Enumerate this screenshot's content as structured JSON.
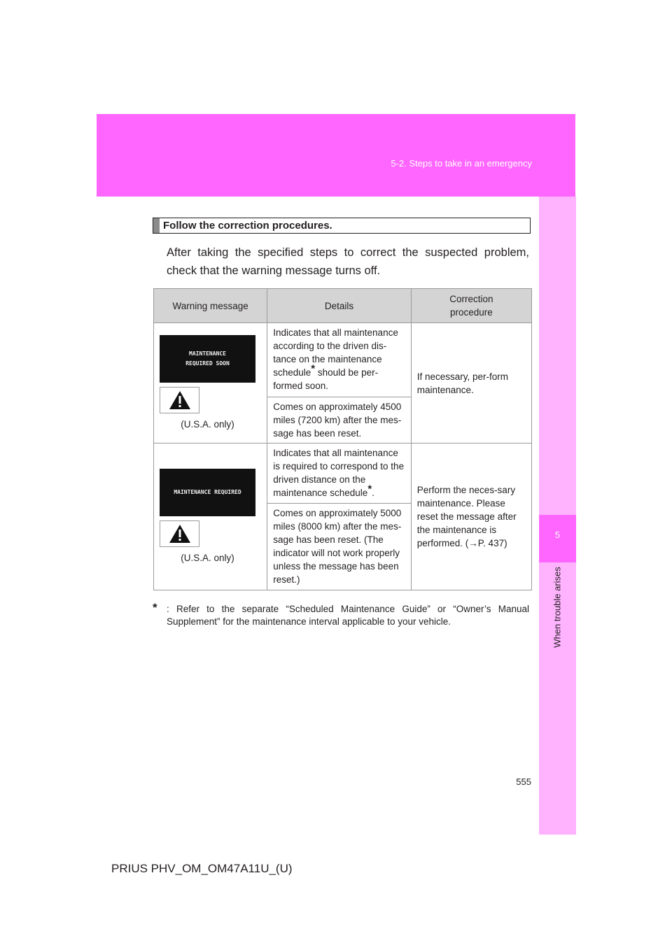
{
  "header": {
    "section": "5-2. Steps to take in an emergency"
  },
  "side_tab": {
    "chapter_number": "5",
    "chapter_title": "When trouble arises"
  },
  "step": {
    "heading": "Follow the correction procedures.",
    "intro": "After taking the specified steps to correct the suspected problem, check that the warning message turns off."
  },
  "table": {
    "headers": {
      "warning_message": "Warning message",
      "details": "Details",
      "correction": "Correction procedure"
    },
    "rows": [
      {
        "screen_lines": [
          "MAINTENANCE",
          "REQUIRED SOON"
        ],
        "note": "(U.S.A. only)",
        "details_1_before": "Indicates that all maintenance according to the driven dis-tance on the maintenance schedule",
        "details_1_after": " should be per-formed soon.",
        "details_2": "Comes on approximately 4500 miles (7200 km) after the mes-sage has been reset.",
        "correction": "If necessary, per-form maintenance."
      },
      {
        "screen_lines": [
          "MAINTENANCE REQUIRED"
        ],
        "note": "(U.S.A. only)",
        "details_1_before": "Indicates that all maintenance is required to correspond to the driven distance on the maintenance schedule",
        "details_1_after": ".",
        "details_2": "Comes on approximately 5000 miles (8000 km) after the mes-sage has been reset. (The indicator will not work properly unless the message has been reset.)",
        "correction": "Perform the neces-sary maintenance. Please reset the message after the maintenance is performed. (→P. 437)"
      }
    ],
    "asterisk": "*"
  },
  "footnote": {
    "mark": "*",
    "text": ": Refer to the separate “Scheduled Maintenance Guide” or “Owner’s Manual Supplement” for the maintenance interval applicable to your vehicle."
  },
  "page_number": "555",
  "doc_code": "PRIUS PHV_OM_OM47A11U_(U)",
  "colors": {
    "header_band": "#ff66ff",
    "side_tab": "#ffb3ff",
    "table_header": "#d4d4d4"
  },
  "icons": [
    "warning-triangle-icon"
  ]
}
